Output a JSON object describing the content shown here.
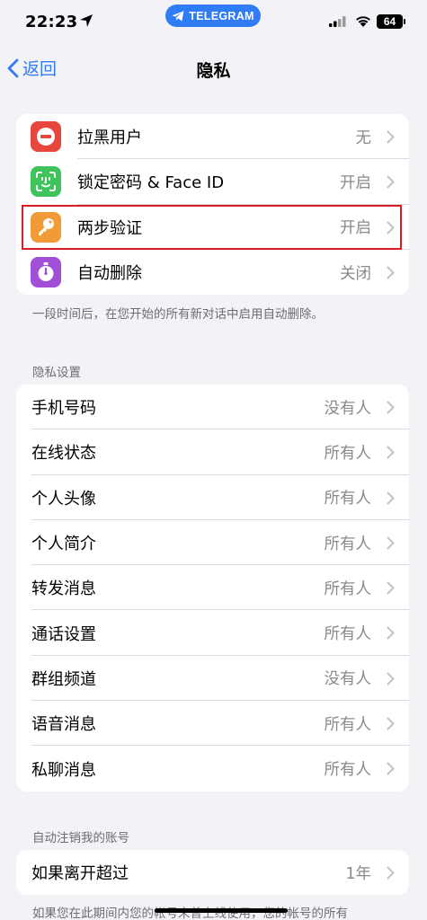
{
  "status_bar": {
    "time": "22:23",
    "telegram_pill": "TELEGRAM",
    "battery": "64"
  },
  "nav": {
    "back_label": "返回",
    "title": "隐私"
  },
  "security_group": [
    {
      "label": "拉黑用户",
      "value": "无",
      "icon": "blocked-icon",
      "color": "#e8453c"
    },
    {
      "label": "锁定密码 & Face ID",
      "value": "开启",
      "icon": "face-id-icon",
      "color": "#3ec45a"
    },
    {
      "label": "两步验证",
      "value": "开启",
      "icon": "key-icon",
      "color": "#f19a38"
    },
    {
      "label": "自动删除",
      "value": "关闭",
      "icon": "timer-icon",
      "color": "#a24fd8"
    }
  ],
  "auto_delete_note": "一段时间后，在您开始的所有新对话中启用自动删除。",
  "privacy_section": {
    "header": "隐私设置",
    "rows": [
      {
        "label": "手机号码",
        "value": "没有人"
      },
      {
        "label": "在线状态",
        "value": "所有人"
      },
      {
        "label": "个人头像",
        "value": "所有人"
      },
      {
        "label": "个人简介",
        "value": "所有人"
      },
      {
        "label": "转发消息",
        "value": "所有人"
      },
      {
        "label": "通话设置",
        "value": "所有人"
      },
      {
        "label": "群组频道",
        "value": "没有人"
      },
      {
        "label": "语音消息",
        "value": "所有人"
      },
      {
        "label": "私聊消息",
        "value": "所有人"
      }
    ]
  },
  "account_section": {
    "header": "自动注销我的账号",
    "rows": [
      {
        "label": "如果离开超过",
        "value": "1年"
      }
    ],
    "footnote": "如果您在此期间内您的帐号未曾上线使用，您的帐号的所有"
  },
  "colors": {
    "accent": "#2f7cf6",
    "highlight_border": "#d91c24"
  }
}
